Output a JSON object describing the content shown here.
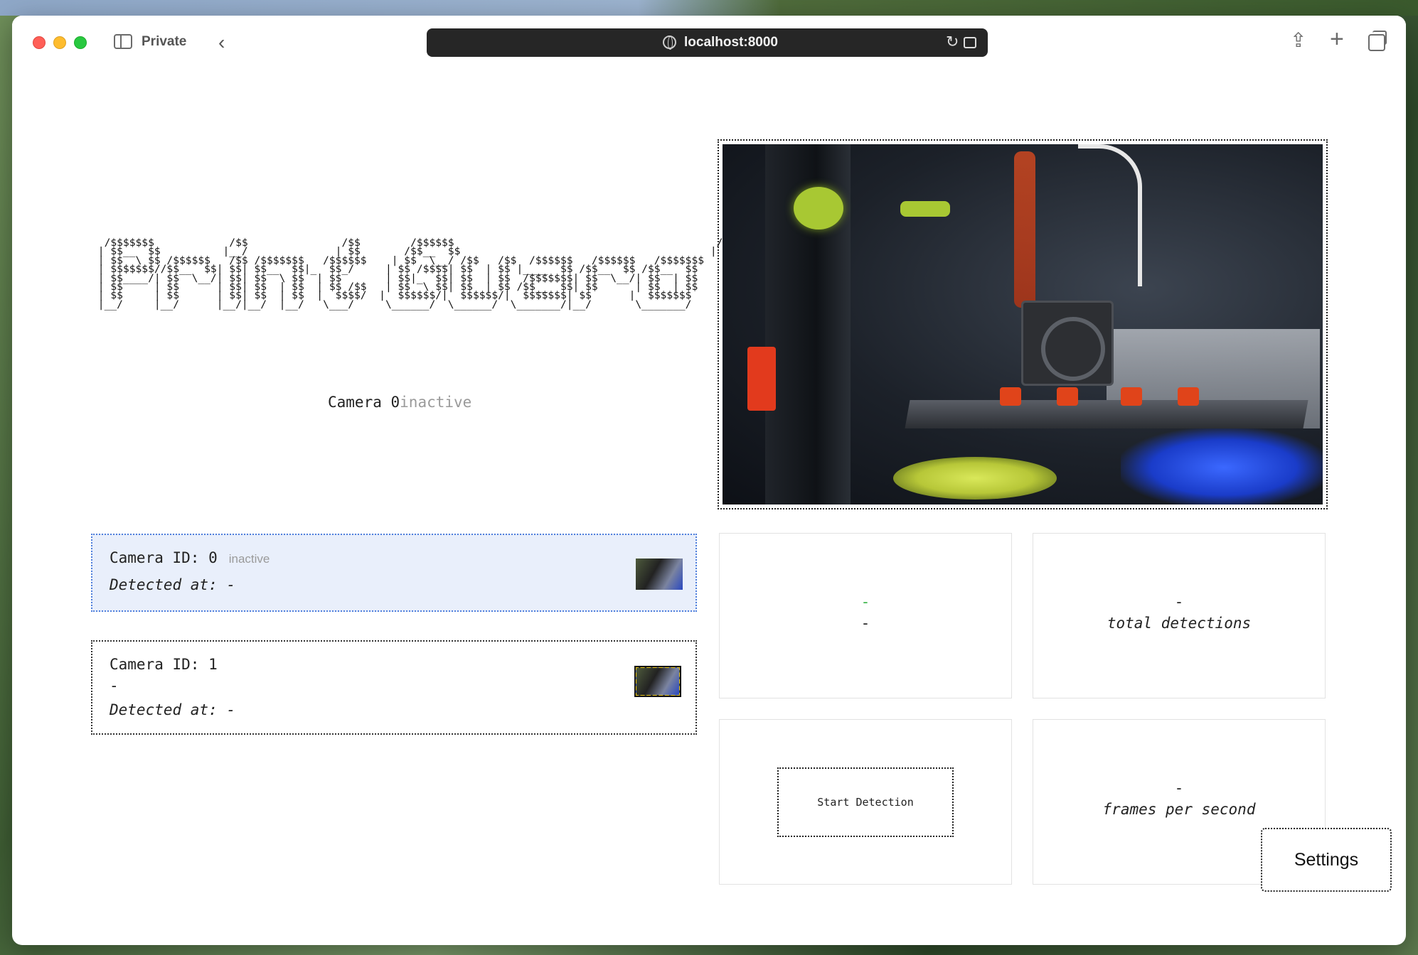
{
  "browser": {
    "private_label": "Private",
    "url": "localhost:8000"
  },
  "page": {
    "ascii_banner": "  /$$$$$$$            /$$               /$$        /$$$$$$                                          /$$\n | $$__  $$          |__/              | $$       /$$__  $$                                        | $$\n | $$  \\ $$ /$$$$$$   /$$ /$$$$$$$   /$$$$$$    | $$  \\__/ /$$   /$$  /$$$$$$   /$$$$$$   /$$$$$$$\n | $$$$$$$//$$__  $$| $$| $$__  $$|_  $$_/     | $$ /$$$$| $$  | $$ |____  $$ /$$__  $$ /$$__  $$\n | $$____/| $$  \\__/| $$| $$  \\ $$  | $$       | $$|_  $$| $$  | $$  /$$$$$$$| $$  \\__/| $$  | $$\n | $$     | $$      | $$| $$  | $$  | $$ /$$   | $$  \\ $$| $$  | $$ /$$__  $$| $$      | $$  | $$\n | $$     | $$      | $$| $$  | $$  |  $$$$/  |  $$$$$$/|  $$$$$$/|  $$$$$$$| $$      |  $$$$$$$\n |__/     |__/      |__/|__/  |__/   \\___/     \\______/  \\______/  \\_______/|__/       \\_______/",
    "camera_status_label": "Camera 0",
    "camera_status_state": "inactive",
    "cameras": [
      {
        "id_label": "Camera ID: 0",
        "state": "inactive",
        "detected_label": "Detected at: -"
      },
      {
        "id_label": "Camera ID: 1",
        "state": "-",
        "detected_label": "Detected at: -"
      }
    ],
    "stats": {
      "status_top": "-",
      "status_bottom": "-",
      "total_detections_value": "-",
      "total_detections_label": "total detections",
      "fps_value": "-",
      "fps_label": "frames per second"
    },
    "start_button_label": "Start Detection",
    "settings_button_label": "Settings"
  },
  "colors": {
    "active_card_bg": "#e9effb",
    "active_card_border": "#4f7fdc",
    "status_green": "#3bb54a",
    "inactive_text": "#9a9a9a"
  }
}
